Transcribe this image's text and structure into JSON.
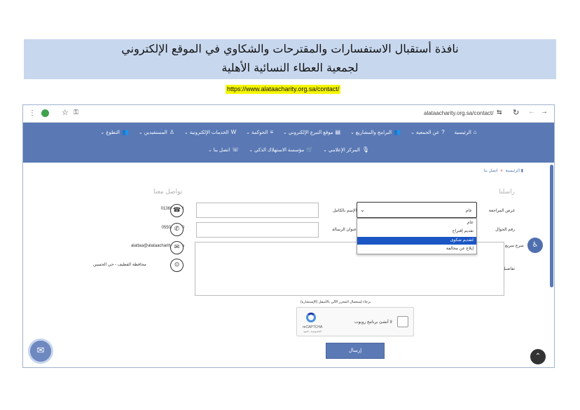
{
  "document": {
    "title_line1": "نافذة أستقبال الاستفسارات والمقترحات والشكاوي في الموقع الإلكتروني",
    "title_line2": "لجمعية العطاء النسائية الأهلية",
    "url": "https://www.alataacharity.org.sa/contact/"
  },
  "browser": {
    "address": "alataacharity.org.sa/contact/",
    "icons": [
      "menu-dots-icon",
      "extension-icon",
      "star-icon",
      "key-icon",
      "tune-icon",
      "reload-icon",
      "forward-icon",
      "back-icon"
    ]
  },
  "nav": {
    "row1": [
      {
        "icon": "⌂",
        "label": "الرئيسية"
      },
      {
        "icon": "?",
        "label": "عن الجمعية ⌄"
      },
      {
        "icon": "👥",
        "label": "البرامج والمشاريع ⌄"
      },
      {
        "icon": "▤",
        "label": "موقع التبرع الإلكتروني ⌄"
      },
      {
        "icon": "≡",
        "label": "الحوكمة ⌄"
      },
      {
        "icon": "W",
        "label": "الخدمات الإلكترونية ⌄"
      },
      {
        "icon": "♙",
        "label": "المستفيدين ⌄"
      },
      {
        "icon": "👥",
        "label": "التطوع ⌄"
      }
    ],
    "row2": [
      {
        "icon": "🎙",
        "label": "المركز الإعلامي ⌄"
      },
      {
        "icon": "🛒",
        "label": "مؤسسة الاستهلاك الذكي ⌄"
      },
      {
        "icon": "☏",
        "label": "اتصل بنا ⌄"
      }
    ]
  },
  "breadcrumb": {
    "home": "الرئيسية",
    "separator": "»",
    "current": "اتصل بنا"
  },
  "form": {
    "heading": "راسلنا",
    "purpose_label": "غرض المراجعة",
    "purpose_value": "عام",
    "purpose_options": [
      "عام",
      "تقديم إقتراح",
      "لتقديم شكوى",
      "إبلاغ عن مخالفة"
    ],
    "purpose_highlighted": "لتقديم شكوى",
    "name_label": "الإسم بالكامل",
    "mobile_label": "رقم الجوال",
    "subject_label": "عنوان الرسالة",
    "details_label": "تفاصيل الرسالة",
    "editor_note": "برجاء إستعمال المحرر الآلي بالأسفل (الإستشارة)",
    "captcha_label": "لا أنشئ برنامج روبوت",
    "captcha_brand": "reCAPTCHA",
    "captcha_terms": "الخصوصية - البنود",
    "submit_label": "إرسال"
  },
  "contact_info": {
    "heading": "تواصل معنا",
    "phone": "0136635121",
    "mobile": "0550411129",
    "email": "alattaa@alataacharity.org.sa",
    "address": "محافظة القطيف - حي الحسين"
  },
  "quick_access": {
    "label": "سرع سريع"
  }
}
